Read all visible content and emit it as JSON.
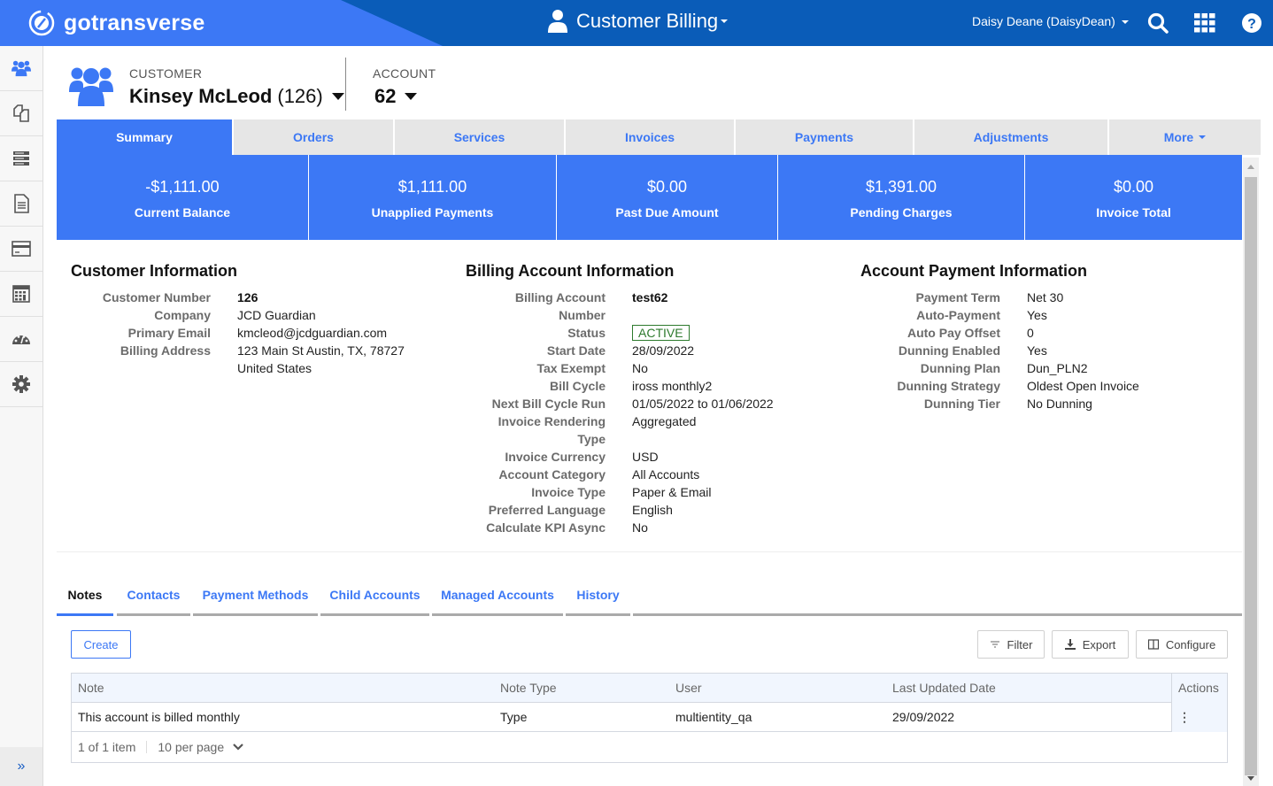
{
  "topbar": {
    "brand": "gotransverse",
    "app_title": "Customer Billing",
    "user": "Daisy Deane (DaisyDean)",
    "icons": [
      "search-icon",
      "apps-grid-icon",
      "help-icon"
    ],
    "colors": {
      "bar": "#0a5cb8",
      "logo_area": "#3c78f5"
    }
  },
  "sidebar": {
    "items": [
      {
        "icon": "customers-icon",
        "active": true
      },
      {
        "icon": "orders-icon"
      },
      {
        "icon": "services-icon"
      },
      {
        "icon": "invoice-document-icon"
      },
      {
        "icon": "payment-card-icon"
      },
      {
        "icon": "calculator-icon"
      },
      {
        "icon": "dashboard-gauge-icon"
      },
      {
        "icon": "settings-gear-icon"
      }
    ],
    "expand_label": "»"
  },
  "header": {
    "customer_label": "CUSTOMER",
    "customer_name": "Kinsey McLeod",
    "customer_number": "(126)",
    "account_label": "ACCOUNT",
    "account_value": "62"
  },
  "tabs": [
    {
      "label": "Summary",
      "active": true
    },
    {
      "label": "Orders"
    },
    {
      "label": "Services"
    },
    {
      "label": "Invoices"
    },
    {
      "label": "Payments"
    },
    {
      "label": "Adjustments"
    },
    {
      "label": "More"
    }
  ],
  "kpis": [
    {
      "value": "-$1,111.00",
      "label": "Current Balance"
    },
    {
      "value": "$1,111.00",
      "label": "Unapplied Payments"
    },
    {
      "value": "$0.00",
      "label": "Past Due Amount"
    },
    {
      "value": "$1,391.00",
      "label": "Pending Charges"
    },
    {
      "value": "$0.00",
      "label": "Invoice Total"
    }
  ],
  "customer_info": {
    "title": "Customer Information",
    "rows": [
      {
        "k": "Customer Number",
        "v": "126"
      },
      {
        "k": "Company",
        "v": "JCD Guardian"
      },
      {
        "k": "Primary Email",
        "v": "kmcleod@jcdguardian.com"
      },
      {
        "k": "Billing Address",
        "v": "123 Main St Austin, TX, 78727"
      },
      {
        "k": "",
        "v": "United States"
      }
    ]
  },
  "billing_info": {
    "title": "Billing Account Information",
    "rows": [
      {
        "k": "Billing Account",
        "v": "test62"
      },
      {
        "k": "Number",
        "v": ""
      },
      {
        "k": "Status",
        "v": "ACTIVE"
      },
      {
        "k": "Start Date",
        "v": "28/09/2022"
      },
      {
        "k": "Tax Exempt",
        "v": "No"
      },
      {
        "k": "Bill Cycle",
        "v": "iross monthly2"
      },
      {
        "k": "Next Bill Cycle Run",
        "v": "01/05/2022 to 01/06/2022"
      },
      {
        "k": "Invoice Rendering",
        "v": "Aggregated"
      },
      {
        "k": "Type",
        "v": ""
      },
      {
        "k": "Invoice Currency",
        "v": "USD"
      },
      {
        "k": "Account Category",
        "v": "All Accounts"
      },
      {
        "k": "Invoice Type",
        "v": "Paper & Email"
      },
      {
        "k": "Preferred Language",
        "v": "English"
      },
      {
        "k": "Calculate KPI Async",
        "v": "No"
      }
    ]
  },
  "payment_info": {
    "title": "Account Payment Information",
    "rows": [
      {
        "k": "Payment Term",
        "v": "Net 30"
      },
      {
        "k": "Auto-Payment",
        "v": "Yes"
      },
      {
        "k": "Auto Pay Offset",
        "v": "0"
      },
      {
        "k": "Dunning Enabled",
        "v": "Yes"
      },
      {
        "k": "Dunning Plan",
        "v": "Dun_PLN2"
      },
      {
        "k": "Dunning Strategy",
        "v": "Oldest Open Invoice"
      },
      {
        "k": "Dunning Tier",
        "v": "No Dunning"
      }
    ]
  },
  "subtabs": [
    {
      "label": "Notes",
      "active": true
    },
    {
      "label": "Contacts"
    },
    {
      "label": "Payment Methods"
    },
    {
      "label": "Child Accounts"
    },
    {
      "label": "Managed Accounts"
    },
    {
      "label": "History"
    }
  ],
  "notes_toolbar": {
    "create": "Create",
    "filter": "Filter",
    "export": "Export",
    "configure": "Configure"
  },
  "notes_table": {
    "columns": [
      "Note",
      "Note Type",
      "User",
      "Last Updated Date",
      "Actions"
    ],
    "rows": [
      [
        "This account is billed monthly",
        "Type",
        "multientity_qa",
        "29/09/2022",
        "⋮"
      ]
    ],
    "pager": {
      "summary": "1 of 1 item",
      "per_page": "10 per page"
    }
  }
}
